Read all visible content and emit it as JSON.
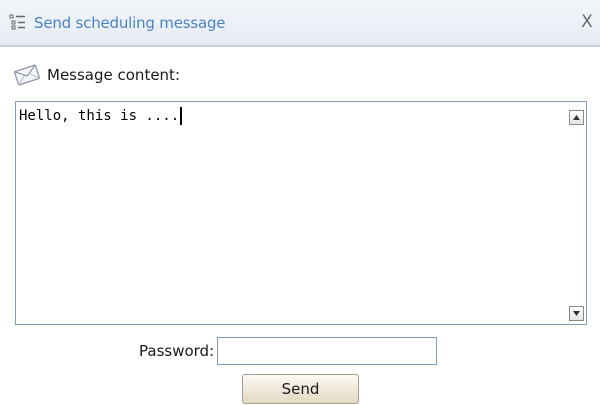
{
  "dialog": {
    "title": "Send scheduling message",
    "close_label": "X"
  },
  "message": {
    "label": "Message content:",
    "value": "Hello, this is ...."
  },
  "password": {
    "label": "Password:",
    "value": ""
  },
  "actions": {
    "send_label": "Send"
  },
  "colors": {
    "title_text": "#4a84c2",
    "field_border": "#7f9db9",
    "button_bg": "#efe8d8"
  },
  "icons": {
    "title": "list-icon",
    "message": "envelope-icon",
    "scroll_up": "arrow-up-icon",
    "scroll_down": "arrow-down-icon",
    "close": "close-icon"
  }
}
